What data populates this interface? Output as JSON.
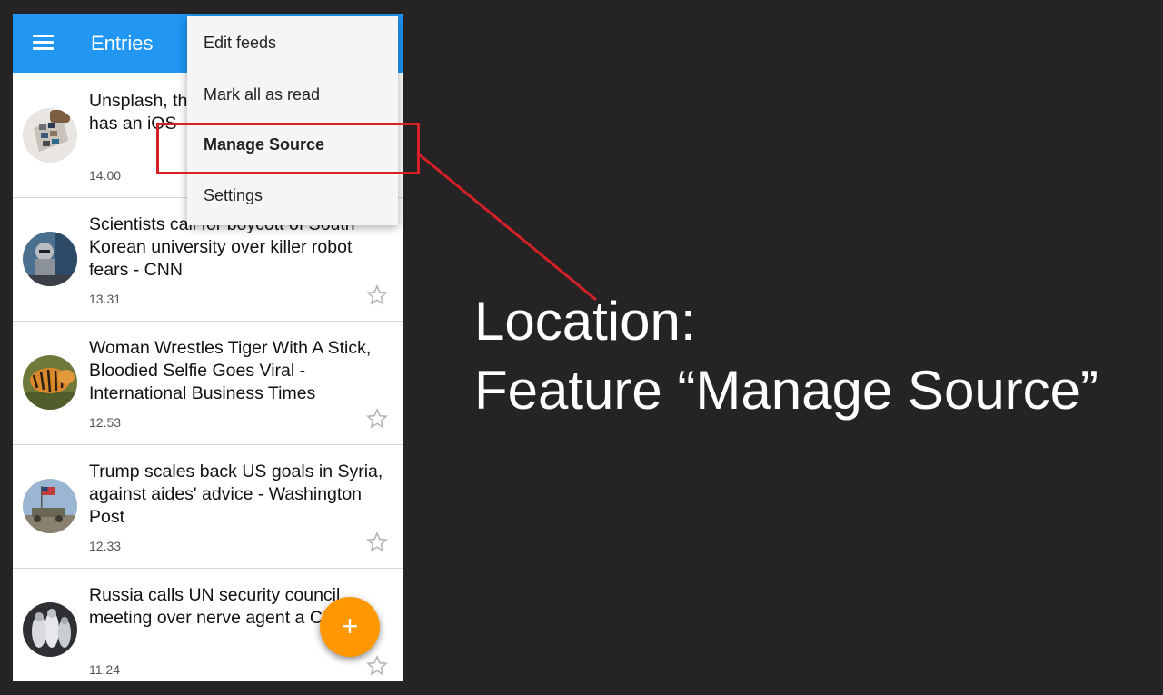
{
  "app_bar": {
    "title": "Entries",
    "menu_icon": "hamburger-menu-icon",
    "color": "#2196f3"
  },
  "entries": [
    {
      "title": "Unsplash, the favorite stock photo site, has an iOS",
      "time": "14.00",
      "thumb_icon": "unsplash-thumbnail"
    },
    {
      "title": "Scientists call for boycott of South Korean university over killer robot fears - CNN",
      "time": "13.31",
      "thumb_icon": "robot-thumbnail"
    },
    {
      "title": "Woman Wrestles Tiger With A Stick, Bloodied Selfie Goes Viral - International Business Times",
      "time": "12.53",
      "thumb_icon": "tiger-thumbnail"
    },
    {
      "title": "Trump scales back US goals in Syria, against aides' advice - Washington Post",
      "time": "12.33",
      "thumb_icon": "syria-flag-thumbnail"
    },
    {
      "title": "Russia calls UN security council meeting over nerve agent a CNN",
      "time": "11.24",
      "thumb_icon": "hazmat-thumbnail"
    }
  ],
  "overflow_menu": {
    "items": [
      {
        "label": "Edit feeds"
      },
      {
        "label": "Mark all as read"
      },
      {
        "label": "Manage Source"
      },
      {
        "label": "Settings"
      }
    ]
  },
  "fab": {
    "label": "+",
    "color": "#ff9800"
  },
  "annotation": {
    "line1": "Location:",
    "line2": "Feature “Manage Source”",
    "color": "#d42027"
  }
}
